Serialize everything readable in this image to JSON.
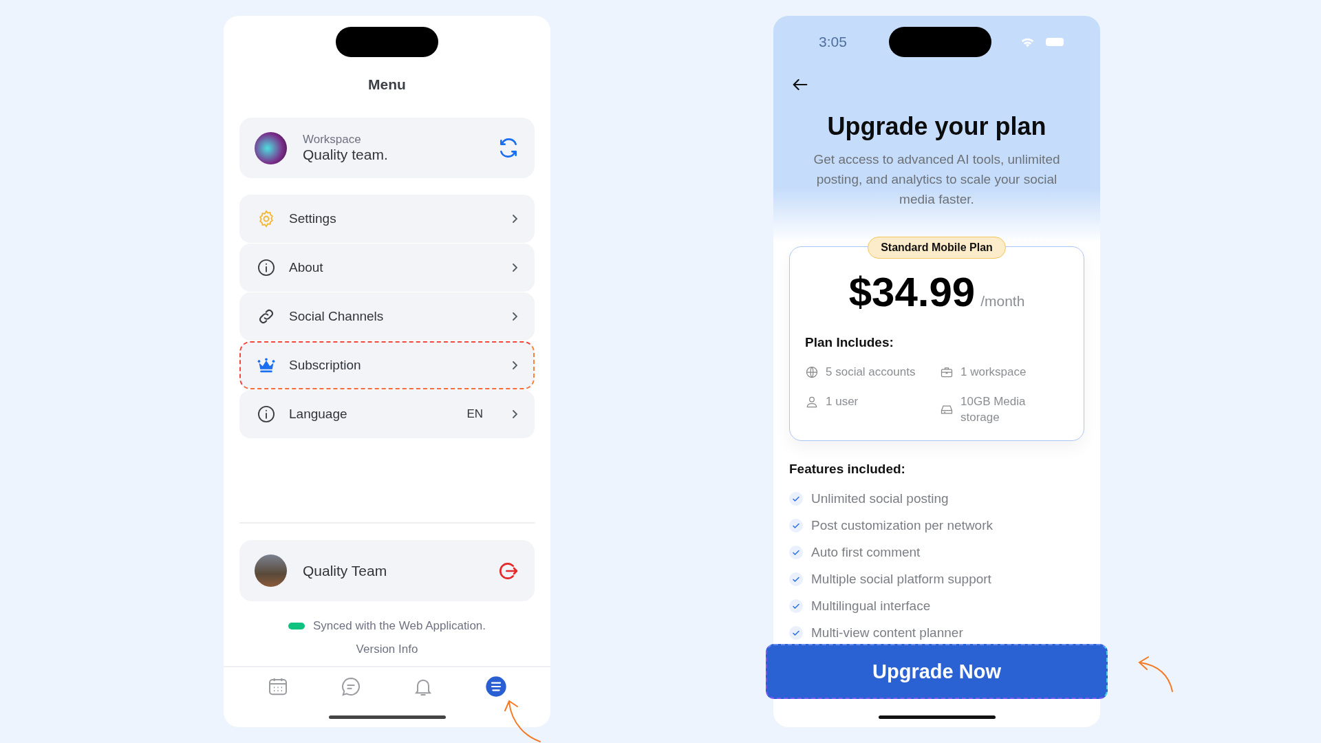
{
  "menu_screen": {
    "title": "Menu",
    "workspace": {
      "label": "Workspace",
      "name": "Quality team."
    },
    "items": [
      {
        "label": "Settings",
        "highlighted": false
      },
      {
        "label": "About",
        "highlighted": false
      },
      {
        "label": "Social Channels",
        "highlighted": false
      },
      {
        "label": "Subscription",
        "highlighted": true
      },
      {
        "label": "Language",
        "value": "EN",
        "highlighted": false
      }
    ],
    "profile": {
      "name": "Quality Team"
    },
    "sync_status": "Synced with the Web Application.",
    "version_link": "Version Info",
    "tab_bar": [
      {
        "selected": false
      },
      {
        "selected": false
      },
      {
        "selected": false
      },
      {
        "selected": true
      }
    ]
  },
  "upgrade_screen": {
    "status_bar": {
      "time": "3:05"
    },
    "title": "Upgrade your plan",
    "description": "Get access to advanced AI tools, unlimited posting, and analytics to scale your social media faster.",
    "plan": {
      "badge": "Standard Mobile Plan",
      "price": "$34.99",
      "period": "/month",
      "includes_title": "Plan Includes:",
      "includes": [
        "5 social accounts",
        "1 workspace",
        "1 user",
        "10GB Media storage"
      ]
    },
    "features_title": "Features included:",
    "features": [
      "Unlimited social posting",
      "Post customization per network",
      "Auto first comment",
      "Multiple social platform support",
      "Multilingual interface",
      "Multi-view content planner"
    ],
    "button": "Upgrade Now"
  }
}
